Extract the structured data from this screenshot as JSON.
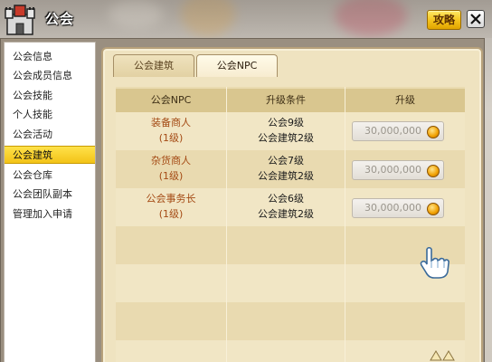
{
  "window": {
    "title": "公会",
    "guide_label": "攻略"
  },
  "sidebar": {
    "items": [
      {
        "label": "公会信息",
        "active": false
      },
      {
        "label": "公会成员信息",
        "active": false
      },
      {
        "label": "公会技能",
        "active": false
      },
      {
        "label": "个人技能",
        "active": false
      },
      {
        "label": "公会活动",
        "active": false
      },
      {
        "label": "公会建筑",
        "active": true
      },
      {
        "label": "公会仓库",
        "active": false
      },
      {
        "label": "公会团队副本",
        "active": false
      },
      {
        "label": "管理加入申请",
        "active": false
      }
    ]
  },
  "tabs": [
    {
      "label": "公会建筑",
      "selected": false
    },
    {
      "label": "公会NPC",
      "selected": true
    }
  ],
  "table": {
    "headers": [
      "公会NPC",
      "升级条件",
      "升级"
    ],
    "rows": [
      {
        "name": "装备商人",
        "level": "(1级)",
        "cond1": "公会9级",
        "cond2": "公会建筑2级",
        "price": "30,000,000"
      },
      {
        "name": "杂货商人",
        "level": "(1级)",
        "cond1": "公会7级",
        "cond2": "公会建筑2级",
        "price": "30,000,000"
      },
      {
        "name": "公会事务长",
        "level": "(1级)",
        "cond1": "公会6级",
        "cond2": "公会建筑2级",
        "price": "30,000,000"
      }
    ]
  },
  "colors": {
    "active_tab": "#f3c317",
    "npc_name": "#a44a14",
    "panel_bg": "#efe3c0"
  },
  "icons": [
    "castle-icon",
    "close-icon",
    "coin-icon",
    "hand-cursor-icon"
  ]
}
